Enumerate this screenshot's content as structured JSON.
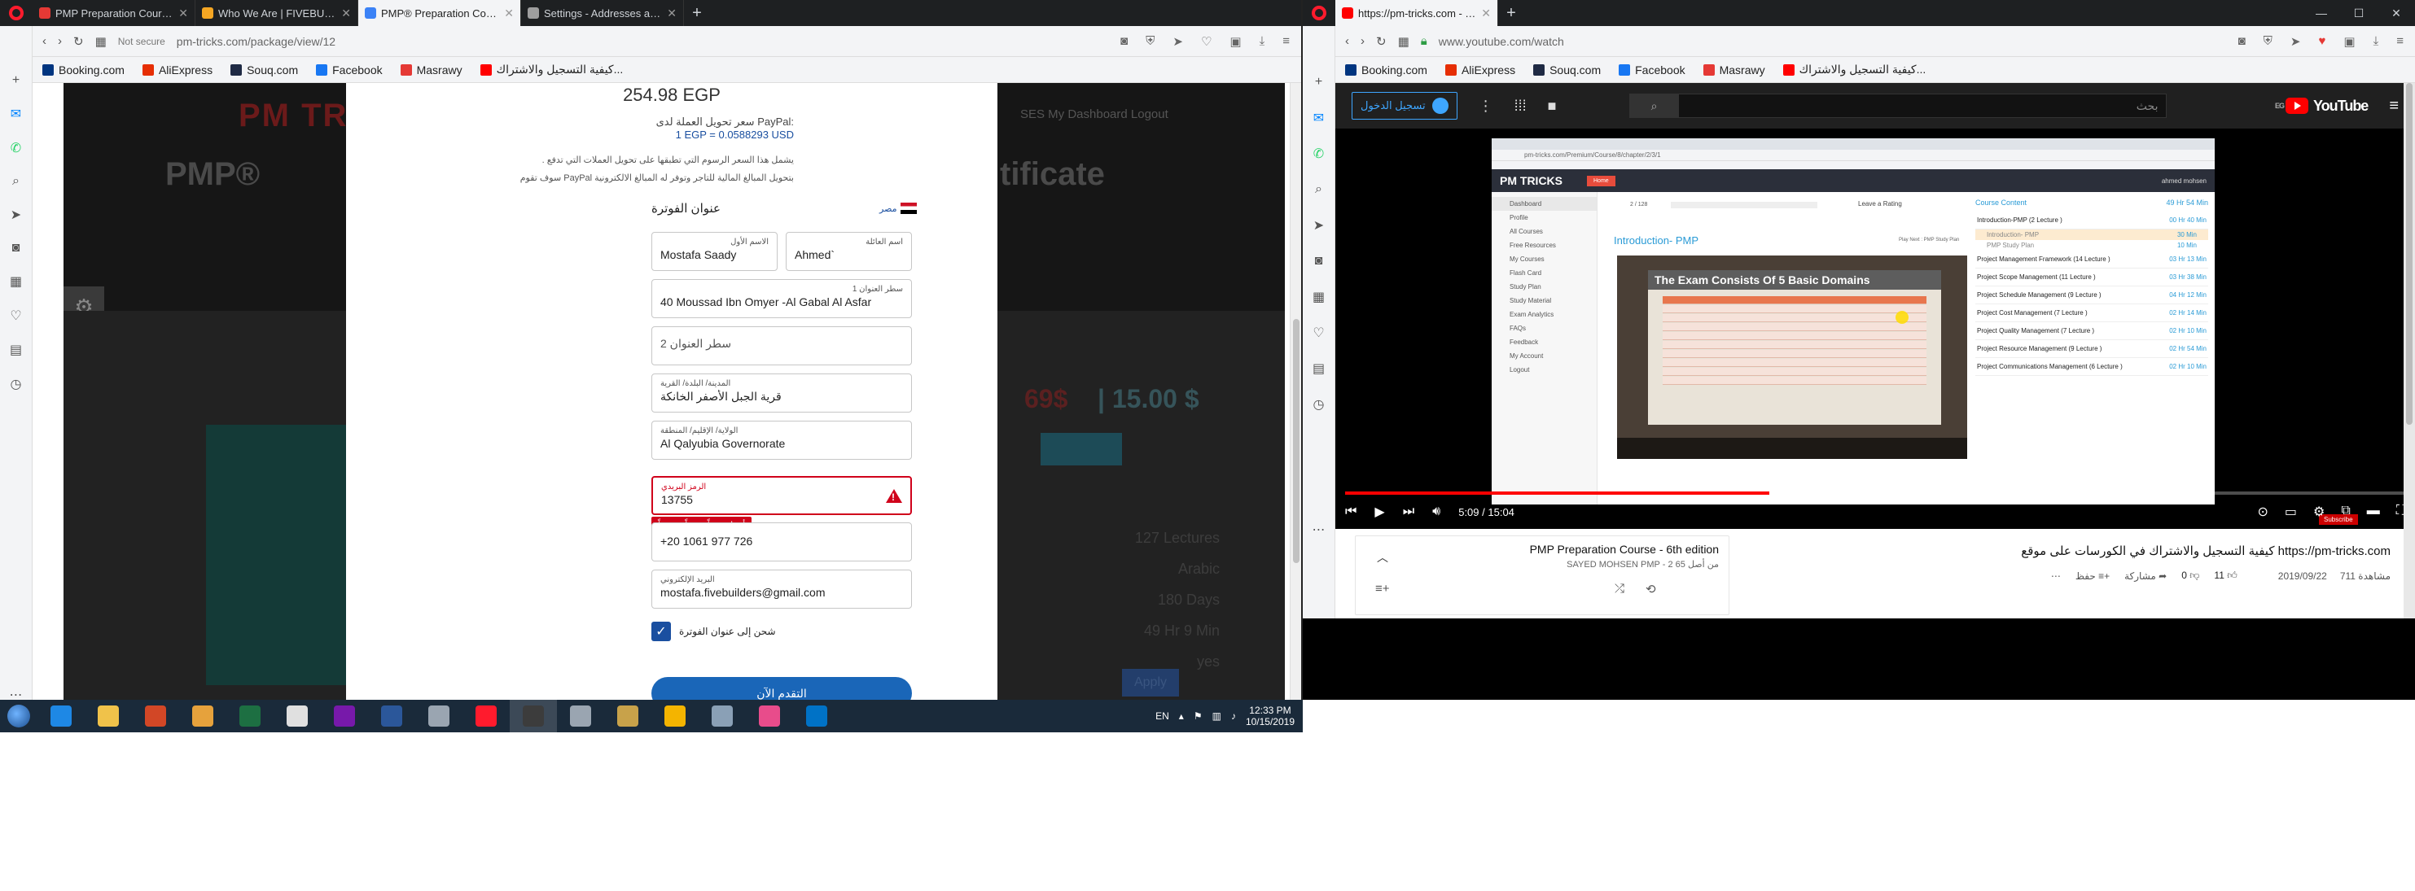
{
  "left_browser": {
    "tabs": [
      {
        "title": "PMP Preparation Course fo",
        "favicon_color": "#e53935"
      },
      {
        "title": "Who We Are | FIVEBUILDE",
        "favicon_color": "#f5a623"
      },
      {
        "title": "PMP® Preparation Course",
        "favicon_color": "#3b82f6"
      },
      {
        "title": "Settings - Addresses and m",
        "favicon_color": "#9e9e9e"
      }
    ],
    "active_tab_index": 2,
    "address": {
      "security": "Not secure",
      "url": "pm-tricks.com/package/view/12"
    },
    "bookmarks": [
      {
        "label": "Booking.com",
        "color": "#003580"
      },
      {
        "label": "AliExpress",
        "color": "#e62e04"
      },
      {
        "label": "Souq.com",
        "color": "#1f2a44"
      },
      {
        "label": "Facebook",
        "color": "#1877f2"
      },
      {
        "label": "Masrawy",
        "color": "#e53935"
      },
      {
        "label": "كيفية التسجيل والاشتراك...",
        "color": "#ff0000"
      }
    ]
  },
  "pm_page": {
    "logo": "PM TRICKS",
    "nav_text": "SES   My Dashboard  Logout",
    "title_left": "PMP®",
    "title_right": "tificate",
    "old_price": "69$",
    "new_price": "| 15.00 $",
    "details": [
      "127 Lectures",
      "Arabic",
      "180 Days",
      "49 Hr 9 Min",
      "yes"
    ],
    "apply_label": "Apply"
  },
  "modal": {
    "price": "254.98 EGP",
    "rate_title": "سعر تحويل العملة لدى PayPal:",
    "rate_value": "1 EGP = 0.0588293 USD",
    "note1": ". يشمل هذا السعر الرسوم التي تطبقها على تحويل العملات التي تدفع",
    "note2": "سوف تقوم PayPal بتحويل المبالغ المالية للتاجر وتوفر له المبالغ الالكترونية",
    "section_title": "عنوان الفوترة",
    "edit_label": "مصر",
    "fields": {
      "first_name": {
        "label": "الاسم الأول",
        "value": "Mostafa Saady"
      },
      "last_name": {
        "label": "اسم العائلة",
        "value": "Ahmed`"
      },
      "address1": {
        "label": "سطر العنوان 1",
        "value": "40 Moussad Ibn Omyer -Al Gabal Al Asfar"
      },
      "address2": {
        "placeholder": "سطر العنوان 2"
      },
      "city": {
        "label": "المدينة/ البلدة/ القرية",
        "value": "قرية الجبل الأصفر الخانكة"
      },
      "governorate": {
        "label": "الولاية/ الإقليم/ المنطقة",
        "value": "Al Qalyubia Governorate"
      },
      "postal": {
        "label": "الرمز البريدي",
        "value": "13755"
      },
      "phone": {
        "value": "+20  1061 977 726"
      },
      "email": {
        "label": "البريد الإلكتروني",
        "value": "mostafa.fivebuilders@gmail.com"
      }
    },
    "error_tip": "أدخل رمزاً بريدياً صحيحاً",
    "ship_label": "شحن إلى عنوان الفوترة",
    "continue_label": "التقدم الآن"
  },
  "taskbar": {
    "apps": [
      {
        "name": "ie",
        "color": "#1e88e5"
      },
      {
        "name": "explorer",
        "color": "#f0c24a"
      },
      {
        "name": "powerpoint",
        "color": "#d24726"
      },
      {
        "name": "media",
        "color": "#e6a23c"
      },
      {
        "name": "excel",
        "color": "#1d6f42"
      },
      {
        "name": "acrobat",
        "color": "#e0e0e0"
      },
      {
        "name": "onenote",
        "color": "#7719aa"
      },
      {
        "name": "word",
        "color": "#2b579a"
      },
      {
        "name": "tool",
        "color": "#9aa5b1"
      },
      {
        "name": "opera",
        "color": "#ff1b2d"
      },
      {
        "name": "app",
        "color": "#3c3c3c"
      },
      {
        "name": "pen",
        "color": "#9aa5b1"
      },
      {
        "name": "files",
        "color": "#c8a24a"
      },
      {
        "name": "camtasia",
        "color": "#f4b400"
      },
      {
        "name": "network",
        "color": "#8aa0b6"
      },
      {
        "name": "itunes",
        "color": "#e84c8b"
      },
      {
        "name": "outlook",
        "color": "#0072c6"
      }
    ],
    "active_index": 10,
    "lang": "EN",
    "time": "12:33 PM",
    "date": "10/15/2019"
  },
  "right_browser": {
    "tabs": [
      {
        "title": "https://pm-tricks.com - Yo",
        "favicon_color": "#ff0000"
      }
    ],
    "address": {
      "url": "www.youtube.com/watch"
    },
    "bookmarks": [
      {
        "label": "Booking.com",
        "color": "#003580"
      },
      {
        "label": "AliExpress",
        "color": "#e62e04"
      },
      {
        "label": "Souq.com",
        "color": "#1f2a44"
      },
      {
        "label": "Facebook",
        "color": "#1877f2"
      },
      {
        "label": "Masrawy",
        "color": "#e53935"
      },
      {
        "label": "كيفية التسجيل والاشتراك...",
        "color": "#ff0000"
      }
    ]
  },
  "youtube": {
    "signin_label": "تسجيل الدخول",
    "search_placeholder": "بحث",
    "logo": "YouTube",
    "country": "EG",
    "time_current": "5:09",
    "time_total": "/ 15:04",
    "video_title": "كيفية التسجيل والاشتراك في الكورسات على موقع https://pm-tricks.com",
    "views": "711 مشاهدة",
    "date": "2019/09/22",
    "likes": "11",
    "dislikes": "0",
    "share_label": "مشاركة",
    "save_label": "حفظ",
    "playlist_title": "PMP Preparation Course - 6th edition",
    "playlist_sub": "SAYED MOHSEN PMP - 2 من أصل 65",
    "subscribe_label": "Subscribe"
  },
  "embedded": {
    "logo": "PM TRICKS",
    "home": "Home",
    "user": "ahmed mohsen",
    "url": "pm-tricks.com/Premium/Course/8/chapter/2/3/1",
    "sidebar": [
      "Dashboard",
      "Profile",
      "All Courses",
      "Free Resources",
      "My Courses",
      "Flash Card",
      "Study Plan",
      "Study Material",
      "Exam Analytics",
      "FAQs",
      "Feedback",
      "My Account",
      "Logout"
    ],
    "counter": "2 / 128",
    "rating": "Leave a Rating",
    "intro_title": "Introduction- PMP",
    "crumb": "Play Next : PMP Study Plan",
    "slide_title": "The Exam Consists Of 5 Basic  Domains",
    "course_content": "Course Content",
    "course_total": "49 Hr 54 Min",
    "rows": [
      {
        "title": "Introduction-PMP (2 Lecture )",
        "time": "00 Hr 40 Min"
      },
      {
        "title": "Introduction- PMP",
        "time": "30 Min",
        "sub": true,
        "hl": true
      },
      {
        "title": "PMP Study Plan",
        "time": "10 Min",
        "sub": true
      },
      {
        "title": "Project Management Framework (14 Lecture )",
        "time": "03 Hr 13 Min"
      },
      {
        "title": "Project Scope Management (11 Lecture )",
        "time": "03 Hr 38 Min"
      },
      {
        "title": "Project Schedule Management (9 Lecture )",
        "time": "04 Hr 12 Min"
      },
      {
        "title": "Project Cost Management (7 Lecture )",
        "time": "02 Hr 14 Min"
      },
      {
        "title": "Project Quality Management (7 Lecture )",
        "time": "02 Hr 10 Min"
      },
      {
        "title": "Project Resource Management (9 Lecture )",
        "time": "02 Hr 54 Min"
      },
      {
        "title": "Project Communications Management (6 Lecture )",
        "time": "02 Hr 10 Min"
      }
    ]
  }
}
